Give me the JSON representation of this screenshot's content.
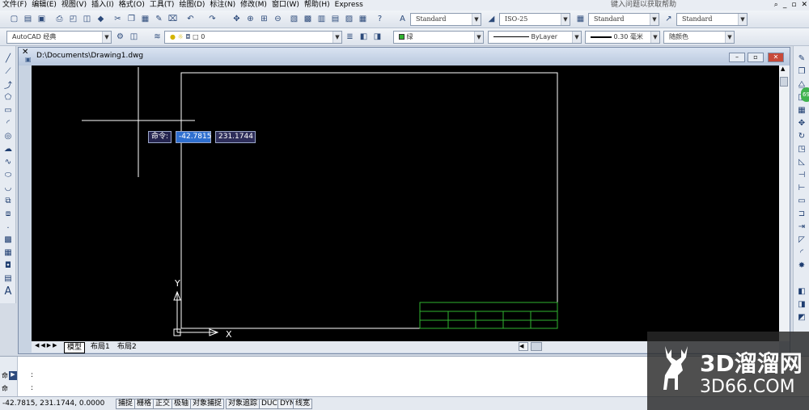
{
  "menu": {
    "items": [
      "文件(F)",
      "编辑(E)",
      "视图(V)",
      "插入(I)",
      "格式(O)",
      "工具(T)",
      "绘图(D)",
      "标注(N)",
      "修改(M)",
      "窗口(W)",
      "帮助(H)",
      "Express"
    ],
    "help_placeholder": "键入问题以获取帮助"
  },
  "toolbar": {
    "text_style": "Standard",
    "dim_style": "ISO-25",
    "table_style": "Standard",
    "multileader_style": "Standard",
    "workspace": "AutoCAD 经典",
    "layer": "0",
    "color": "绿",
    "linetype": "ByLayer",
    "lineweight": "0.30 毫米",
    "plot_style": "随颜色",
    "color_accent": "#31b331"
  },
  "drawing": {
    "title": "D:\\Documents\\Drawing1.dwg",
    "tabs": [
      "模型",
      "布局1",
      "布局2"
    ],
    "dynamic_input": {
      "label": "命令:",
      "x_value": "-42.7815",
      "y_value": "231.1744"
    },
    "ucs": {
      "x_label": "X",
      "y_label": "Y"
    }
  },
  "command": {
    "line1": ":",
    "line2": ":",
    "side_labels": [
      "命",
      "命"
    ]
  },
  "status": {
    "coords": "-42.7815, 231.1744, 0.0000",
    "buttons": [
      "捕捉",
      "栅格",
      "正交",
      "极轴",
      "对象捕捉",
      "对象追踪",
      "DUCS",
      "DYN",
      "线宽"
    ]
  },
  "watermark": {
    "line1": "3D溜溜网",
    "line2": "3D66.COM"
  },
  "badge": "69"
}
